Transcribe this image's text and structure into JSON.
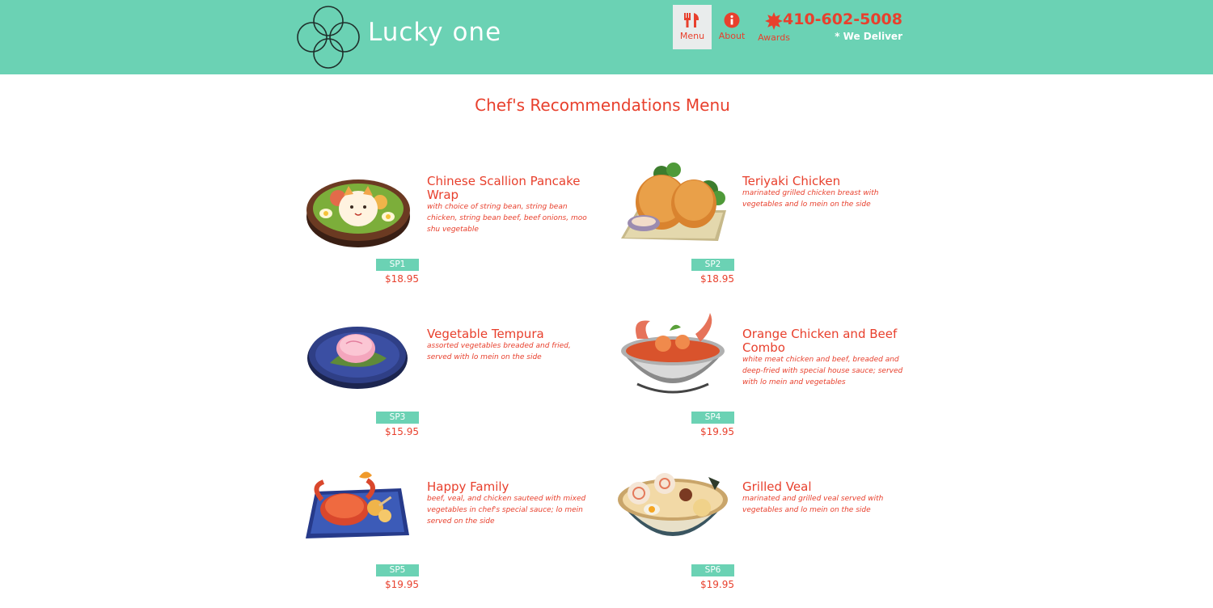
{
  "brand": {
    "name": "Lucky one"
  },
  "nav": [
    {
      "label": "Menu",
      "icon": "fork-knife-icon",
      "active": true
    },
    {
      "label": "About",
      "icon": "info-icon",
      "active": false
    },
    {
      "label": "Awards",
      "icon": "award-badge-icon",
      "active": false
    }
  ],
  "contact": {
    "phone": "410-602-5008",
    "delivery": "* We Deliver"
  },
  "page": {
    "title": "Chef's Recommendations Menu"
  },
  "colors": {
    "header": "#6bd2b4",
    "accent": "#e8402d",
    "badge": "#6bd2b4"
  },
  "items": [
    {
      "name": "Chinese Scallion Pancake Wrap",
      "desc": "with choice of string bean, string bean chicken, string bean beef, beef onions, moo shu vegetable",
      "code": "SP1",
      "price": "$18.95",
      "image": "bento-box-dish"
    },
    {
      "name": "Teriyaki Chicken",
      "desc": "marinated grilled chicken breast with vegetables and lo mein on the side",
      "code": "SP2",
      "price": "$18.95",
      "image": "fried-chicken-dish"
    },
    {
      "name": "Vegetable Tempura",
      "desc": "assorted vegetables breaded and fried, served with lo mein on the side",
      "code": "SP3",
      "price": "$15.95",
      "image": "rice-cake-plate-dish"
    },
    {
      "name": "Orange Chicken and Beef Combo",
      "desc": "white meat chicken and beef, breaded and deep-fried with special house sauce; served with lo mein and vegetables",
      "code": "SP4",
      "price": "$19.95",
      "image": "seafood-soup-bowl-dish"
    },
    {
      "name": "Happy Family",
      "desc": "beef, veal, and chicken sauteed with mixed vegetables in chef's special sauce; lo mein served on the side",
      "code": "SP5",
      "price": "$19.95",
      "image": "crab-platter-dish"
    },
    {
      "name": "Grilled Veal",
      "desc": "marinated and grilled veal served with vegetables and lo mein on the side",
      "code": "SP6",
      "price": "$19.95",
      "image": "ramen-bowl-dish"
    }
  ]
}
